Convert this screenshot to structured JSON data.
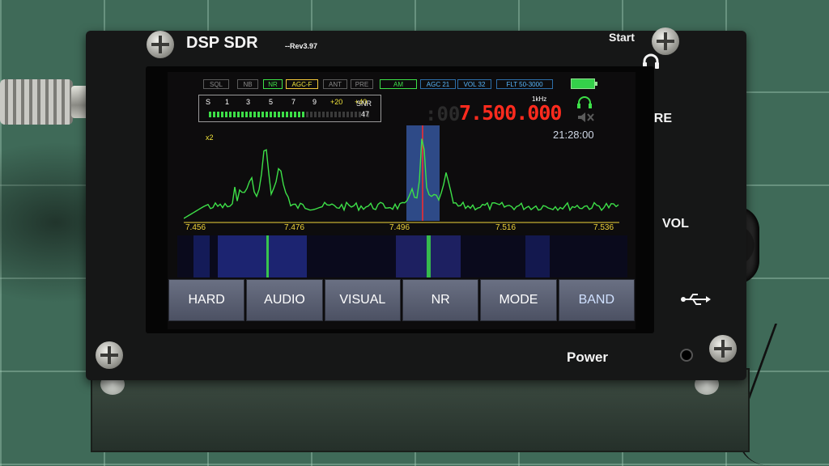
{
  "device": {
    "brand": "DSP SDR",
    "revision": "--Rev3.97",
    "labels": {
      "start": "Start",
      "fre": "FRE",
      "vol": "VOL",
      "power": "Power"
    }
  },
  "screen": {
    "flags": [
      {
        "label": "SQL",
        "state": "off"
      },
      {
        "label": "NB",
        "state": "off"
      },
      {
        "label": "NR",
        "state": "on-green"
      },
      {
        "label": "AGC-F",
        "state": "on-yellow"
      },
      {
        "label": "ANT",
        "state": "off"
      },
      {
        "label": "PRE",
        "state": "off"
      },
      {
        "label": "AM",
        "state": "on-green"
      },
      {
        "label": "AGC 21",
        "state": "on-blue"
      },
      {
        "label": "VOL 32",
        "state": "on-blue"
      },
      {
        "label": "FLT 50-3000",
        "state": "on-blue"
      }
    ],
    "battery_level": 1.0,
    "s_meter": {
      "scale": [
        "S",
        "1",
        "3",
        "5",
        "7",
        "9",
        "+20",
        "+40"
      ],
      "level_fraction": 0.6,
      "snr_label": "SNR",
      "snr_value": "47"
    },
    "frequency": {
      "ghost_digits": ":00",
      "value": "7.500.000",
      "step": "1kHz"
    },
    "zoom": "x2",
    "clock": "21:28:00",
    "freq_axis": [
      "7.456",
      "7.476",
      "7.496",
      "7.516",
      "7.536"
    ],
    "softkeys": [
      "HARD",
      "AUDIO",
      "VISUAL",
      "NR",
      "MODE",
      "BAND"
    ],
    "colors": {
      "frequency": "#ff2b1e",
      "spectrum": "#3de048",
      "axis": "#f0d43a",
      "passband": "#3a5fb0"
    }
  }
}
